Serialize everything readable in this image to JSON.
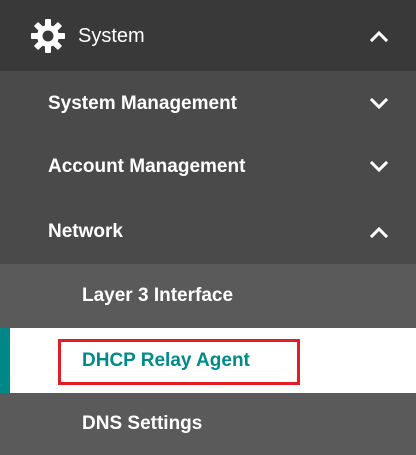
{
  "menu": {
    "system": {
      "label": "System",
      "icon": "gear-icon",
      "expanded": true,
      "toggle_icon": "chevron-up-icon"
    },
    "items": [
      {
        "label": "System Management",
        "expanded": false,
        "toggle_icon": "chevron-down-icon"
      },
      {
        "label": "Account Management",
        "expanded": false,
        "toggle_icon": "chevron-down-icon"
      },
      {
        "label": "Network",
        "expanded": true,
        "toggle_icon": "chevron-up-icon"
      }
    ],
    "network_children": [
      {
        "label": "Layer 3 Interface",
        "active": false
      },
      {
        "label": "DHCP Relay Agent",
        "active": true
      },
      {
        "label": "DNS Settings",
        "active": false
      }
    ]
  },
  "colors": {
    "header_bg": "#393939",
    "sub_bg": "#4a4a4a",
    "leaf_bg": "#5a5a5a",
    "active_text": "#008a8a",
    "active_accent": "#008787",
    "highlight_border": "#e31d25"
  }
}
